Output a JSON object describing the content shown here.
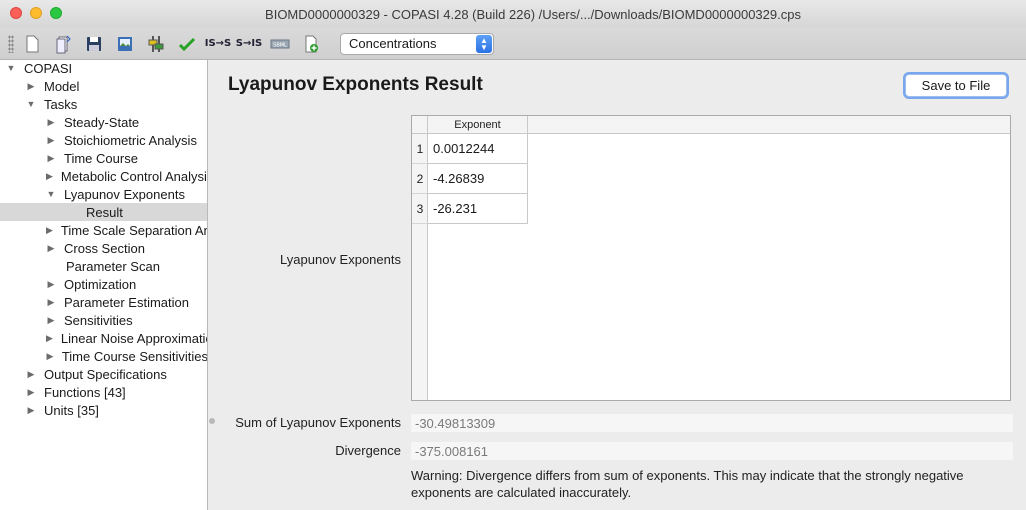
{
  "window": {
    "title": "BIOMD0000000329 - COPASI 4.28 (Build 226) /Users/.../Downloads/BIOMD0000000329.cps"
  },
  "toolbar": {
    "icons": [
      "new-file-icon",
      "open-file-icon",
      "save-icon",
      "save-as-image-icon",
      "sliders-icon",
      "check-model-icon",
      "is-to-s-icon",
      "s-to-is-icon",
      "sbml-icon",
      "add-document-icon"
    ],
    "is_s_label": "IS→S",
    "s_is_label": "S→IS",
    "sbml_label": "SBML",
    "mode_select": "Concentrations"
  },
  "tree": {
    "root": "COPASI",
    "model": "Model",
    "tasks": "Tasks",
    "steady_state": "Steady-State",
    "stoichiometric": "Stoichiometric Analysis",
    "time_course": "Time Course",
    "mca": "Metabolic Control Analysis",
    "lyapunov": "Lyapunov Exponents",
    "result": "Result",
    "tss": "Time Scale Separation Analysis",
    "cross_section": "Cross Section",
    "parameter_scan": "Parameter Scan",
    "optimization": "Optimization",
    "parameter_estimation": "Parameter Estimation",
    "sensitivities": "Sensitivities",
    "lna": "Linear Noise Approximation",
    "tc_sensitivities": "Time Course Sensitivities",
    "output_specifications": "Output Specifications",
    "functions": "Functions [43]",
    "units": "Units [35]"
  },
  "main": {
    "heading": "Lyapunov Exponents Result",
    "save_button": "Save to File",
    "exponents_label": "Lyapunov Exponents",
    "table": {
      "column_header": "Exponent",
      "rows": [
        {
          "index": "1",
          "value": "0.0012244"
        },
        {
          "index": "2",
          "value": "-4.26839"
        },
        {
          "index": "3",
          "value": "-26.231"
        }
      ]
    },
    "sum_label": "Sum of Lyapunov Exponents",
    "sum_value": "-30.49813309",
    "divergence_label": "Divergence",
    "divergence_value": "-375.008161",
    "warning": "Warning: Divergence differs from sum of exponents. This may indicate that the strongly negative exponents are calculated inaccurately."
  },
  "colors": {
    "selection": "#d8d8d8",
    "accent_blue": "#2a72e6"
  }
}
